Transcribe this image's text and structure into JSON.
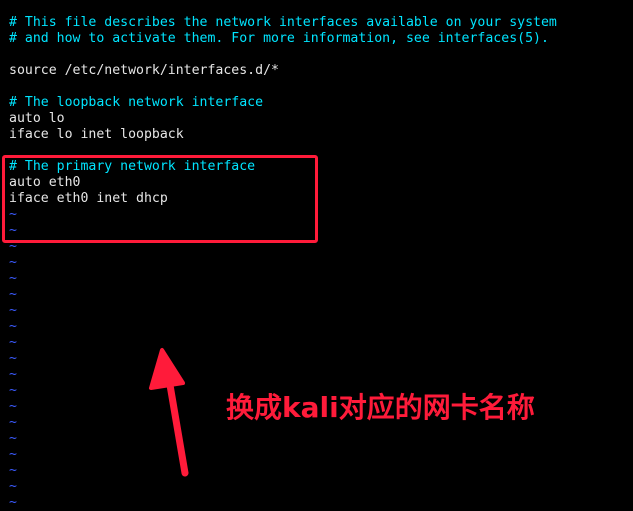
{
  "file_lines": [
    {
      "text": "# This file describes the network interfaces available on your system",
      "kind": "comment"
    },
    {
      "text": "# and how to activate them. For more information, see interfaces(5).",
      "kind": "comment"
    },
    {
      "text": "",
      "kind": "code"
    },
    {
      "text": "source /etc/network/interfaces.d/*",
      "kind": "code"
    },
    {
      "text": "",
      "kind": "code"
    },
    {
      "text": "# The loopback network interface",
      "kind": "comment"
    },
    {
      "text": "auto lo",
      "kind": "code"
    },
    {
      "text": "iface lo inet loopback",
      "kind": "code"
    },
    {
      "text": "",
      "kind": "code"
    },
    {
      "text": "# The primary network interface",
      "kind": "comment"
    },
    {
      "text": "auto eth0",
      "kind": "code"
    },
    {
      "text": "iface eth0 inet dhcp",
      "kind": "code"
    }
  ],
  "empty_line_marker": "~",
  "empty_line_count": 19,
  "annotation": {
    "text": "换成kali对应的网卡名称"
  },
  "colors": {
    "background": "#000000",
    "comment": "#00e5ff",
    "code": "#e6e6e6",
    "tilde": "#3b5bff",
    "annotation": "#ff1b3a"
  }
}
